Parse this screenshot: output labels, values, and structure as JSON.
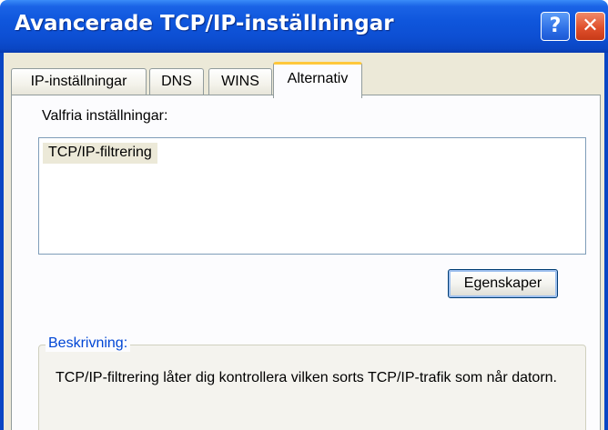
{
  "window": {
    "title": "Avancerade TCP/IP-inställningar",
    "help_label": "?",
    "close_label": "✕"
  },
  "tabs": [
    {
      "label": "IP-inställningar",
      "selected": false
    },
    {
      "label": "DNS",
      "selected": false
    },
    {
      "label": "WINS",
      "selected": false
    },
    {
      "label": "Alternativ",
      "selected": true
    }
  ],
  "options": {
    "label": "Valfria inställningar:",
    "items": [
      "TCP/IP-filtrering"
    ],
    "selected_index": 0
  },
  "properties_button": {
    "label": "Egenskaper"
  },
  "description": {
    "title": "Beskrivning:",
    "text": "TCP/IP-filtrering låter dig kontrollera vilken sorts TCP/IP-trafik som når datorn."
  },
  "colors": {
    "titlebar": "#0a46c4",
    "body": "#ece9d8",
    "active_tab_highlight": "#ffc83c",
    "description_title": "#0046d5"
  }
}
